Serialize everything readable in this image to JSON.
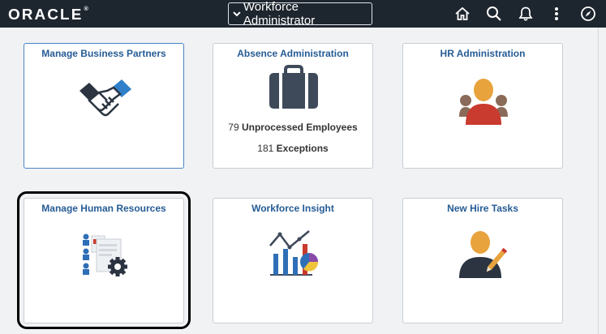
{
  "header": {
    "logo": "ORACLE",
    "logo_mark": "®",
    "homepage_selector": "Workforce Administrator",
    "icons": [
      "home-icon",
      "search-icon",
      "notifications-icon",
      "actions-menu-icon",
      "navbar-icon"
    ]
  },
  "tiles": [
    {
      "title": "Manage Business Partners"
    },
    {
      "title": "Absence Administration",
      "lines": [
        {
          "count": "79",
          "label": "Unprocessed Employees"
        },
        {
          "count": "181",
          "label": "Exceptions"
        }
      ]
    },
    {
      "title": "HR Administration"
    },
    {
      "title": "Manage Human Resources"
    },
    {
      "title": "Workforce Insight"
    },
    {
      "title": "New Hire Tasks"
    }
  ],
  "colors": {
    "header_bg": "#1d252e",
    "tile_title": "#265c95",
    "icon_blue": "#2f6fb7",
    "icon_dark": "#3e4a5a",
    "icon_orange": "#e8a33c",
    "icon_red": "#c93a2f"
  }
}
